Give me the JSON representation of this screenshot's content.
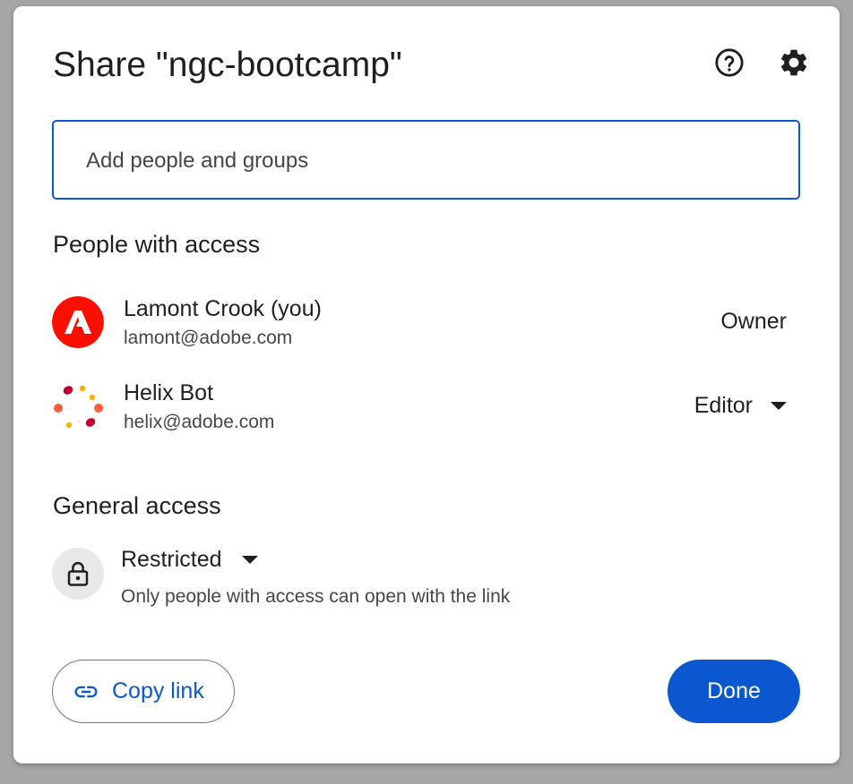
{
  "dialog": {
    "title": "Share \"ngc-bootcamp\"",
    "help_icon": "help-circle-icon",
    "settings_icon": "gear-icon"
  },
  "search": {
    "placeholder": "Add people and groups",
    "value": ""
  },
  "people_with_access": {
    "heading": "People with access",
    "people": [
      {
        "name": "Lamont Crook (you)",
        "email": "lamont@adobe.com",
        "role": "Owner",
        "avatar_icon": "adobe-logo-icon",
        "avatar_color": "#fa0f00"
      },
      {
        "name": "Helix Bot",
        "email": "helix@adobe.com",
        "role": "Editor",
        "avatar_icon": "helix-logo-icon"
      }
    ]
  },
  "general_access": {
    "heading": "General access",
    "level": "Restricted",
    "description": "Only people with access can open with the link",
    "icon": "lock-icon"
  },
  "actions": {
    "copy_link_label": "Copy link",
    "copy_link_icon": "link-icon",
    "done_label": "Done"
  },
  "colors": {
    "accent": "#0b57d0",
    "text_primary": "#1f1f1f",
    "text_secondary": "#444746"
  }
}
